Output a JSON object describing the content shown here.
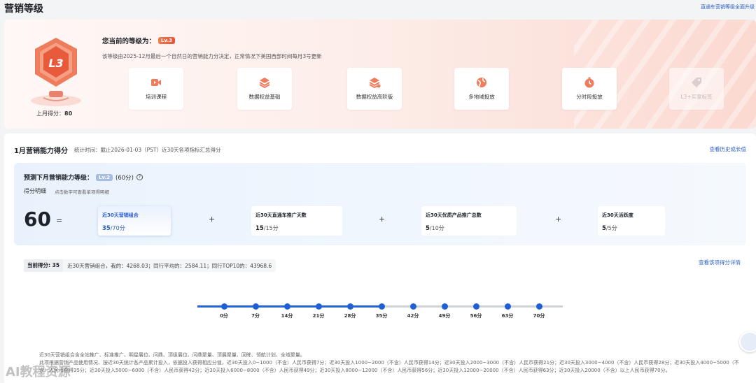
{
  "header": {
    "title": "营销等级",
    "link": "直通车营销等级全面升级"
  },
  "hero": {
    "badge_text": "L3",
    "last_month_label": "上月得分：",
    "last_month_score": "80",
    "current_level_label": "您当前的等级为：",
    "current_level": "Lv.3",
    "description": "该等级由2025-12月最后一个自然日的营销能力分决定，正常情况下美国西部时间每月3号更新",
    "perks": [
      {
        "label": "培训课程",
        "icon": "video-icon",
        "enabled": true
      },
      {
        "label": "数据权益基础",
        "icon": "layers-icon",
        "enabled": true
      },
      {
        "label": "数据权益高阶版",
        "icon": "layers-plus-icon",
        "enabled": true
      },
      {
        "label": "多地域投放",
        "icon": "globe-icon",
        "enabled": true
      },
      {
        "label": "分时段投放",
        "icon": "timer-icon",
        "enabled": true
      },
      {
        "label": "L3+买家标签",
        "icon": "tag-icon",
        "enabled": false
      }
    ]
  },
  "section": {
    "title": "1月营销能力得分",
    "stat": "统计时间：截止2026-01-03（PST）近30天各项指标汇总得分",
    "history_link": "查看历史成长值"
  },
  "prediction": {
    "label": "预测下月营销能力等级：",
    "level": "Lv.2",
    "points": "(60分)",
    "help": "?",
    "breakdown_title": "得分明细",
    "breakdown_hint": "点击数字可查看单项得明细",
    "total": "60",
    "eq": "=",
    "plus": "+",
    "cards": [
      {
        "title": "近30天营销组合",
        "score": "35",
        "max": "/70分",
        "active": true
      },
      {
        "title": "近30天直通车推广天数",
        "score": "15",
        "max": "/15分",
        "active": false
      },
      {
        "title": "近30天优质产品推广总数",
        "score": "5",
        "max": "/10分",
        "active": false
      },
      {
        "title": "近30天活跃度",
        "score": "5",
        "max": "/5分",
        "active": false
      }
    ]
  },
  "detail": {
    "current_label": "当前得分: 35",
    "current_value": "近30天营销组合，我的：4268.03；同行平均的：2584.11；同行TOP10的：43968.6",
    "link": "查看该项得分详情",
    "progress_value": 35,
    "progress_max": 70,
    "ticks": [
      "0分",
      "7分",
      "14分",
      "21分",
      "28分",
      "35分",
      "42分",
      "49分",
      "56分",
      "63分",
      "70分"
    ],
    "rules": [
      "近30天营销组合含全站推广、标准推广、明星展位、问鼎、顶级展位、问鼎聚量、顶展聚量、回眸、领航计划、全域聚量。",
      "此项根据营销产品使用情况、按近30天统计各产品累计投入，依据投入获得相应分值，近30天投入0~1000（不含）人民币获得7分；近30天投入1000~2000（不含）人民币获得14分；近30天投入2000~3000（不含）人民币获得21分；近30天投入3000~4000（不含）人民币获得28分；近30天投入4000~5000（不含）人民币获得35分；近30天投入5000~6000（不含）人民币获得42分；近30天投入6000~8000（不含）人民币获得49分；近30天投入8000~12000（不含）人民币获得56分；近30天投入12000~20000（不含）人民币获得63分；近30天投入20000（不含）以上人民币获得70分。"
    ]
  },
  "watermark": "AI教程资源",
  "colors": {
    "accent": "#2a5fc8",
    "lv3": "#e4553a",
    "lv2": "#a7bde0",
    "progress": "#2463d6"
  }
}
